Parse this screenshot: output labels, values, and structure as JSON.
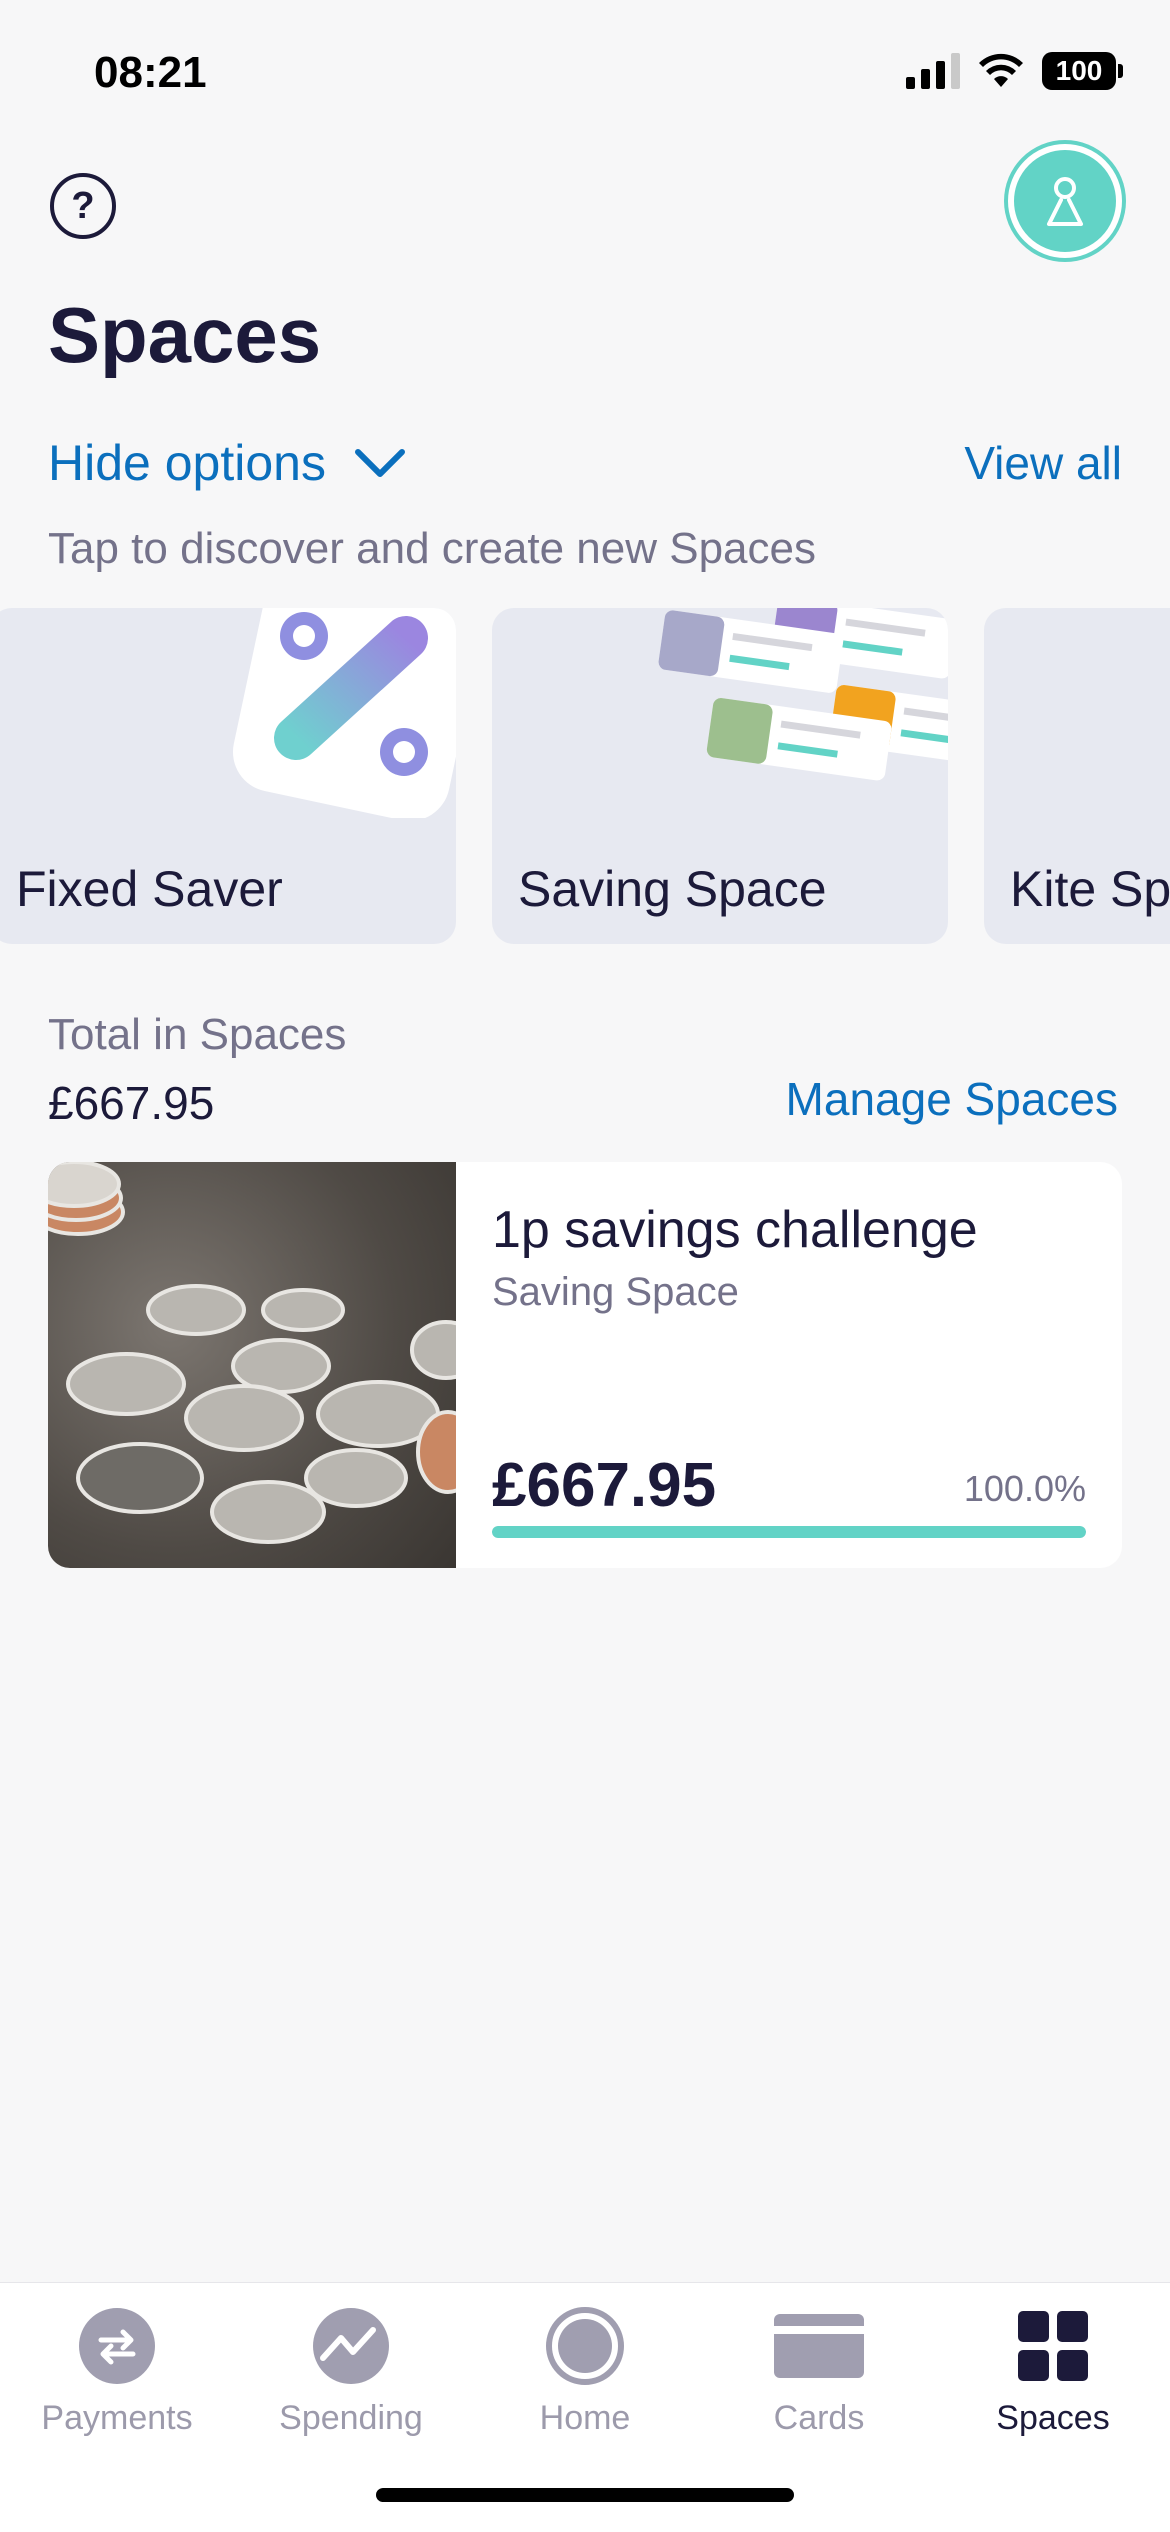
{
  "status_bar": {
    "time": "08:21",
    "battery": "100"
  },
  "header": {
    "title": "Spaces"
  },
  "options": {
    "toggle_label": "Hide options",
    "view_all": "View all",
    "subtitle": "Tap to discover and create new Spaces",
    "cards": [
      {
        "label": "Fixed Saver"
      },
      {
        "label": "Saving Space"
      },
      {
        "label": "Kite Sp"
      }
    ]
  },
  "summary": {
    "total_label": "Total in Spaces",
    "total_amount": "£667.95",
    "manage_label": "Manage Spaces"
  },
  "spaces": [
    {
      "name": "1p savings challenge",
      "type": "Saving Space",
      "amount": "£667.95",
      "progress_label": "100.0%",
      "progress": 1.0
    }
  ],
  "tabbar": {
    "tabs": [
      {
        "label": "Payments",
        "icon": "payments-icon",
        "active": false
      },
      {
        "label": "Spending",
        "icon": "spending-icon",
        "active": false
      },
      {
        "label": "Home",
        "icon": "home-icon",
        "active": false
      },
      {
        "label": "Cards",
        "icon": "cards-icon",
        "active": false
      },
      {
        "label": "Spaces",
        "icon": "spaces-icon",
        "active": true
      }
    ]
  },
  "colors": {
    "accent_blue": "#0b6fbd",
    "accent_teal": "#62d3c6",
    "text_primary": "#1c1a3a",
    "text_secondary": "#74728a"
  }
}
